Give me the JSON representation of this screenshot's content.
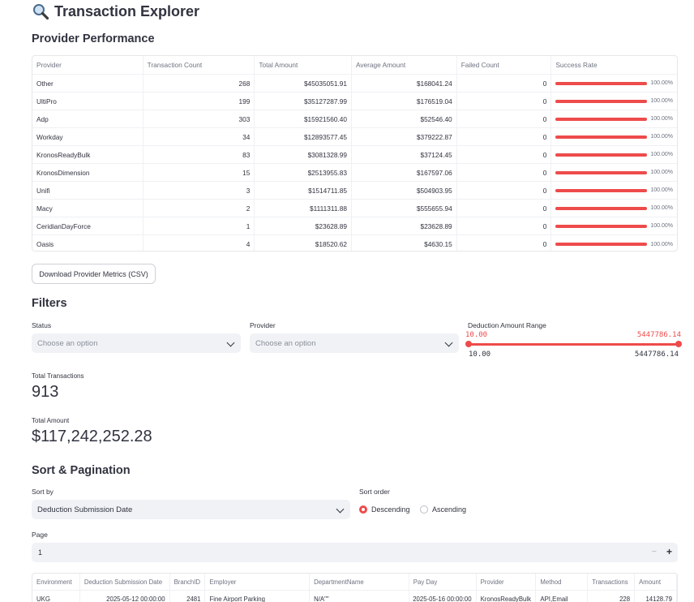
{
  "page": {
    "title": "Transaction Explorer",
    "title_icon": "magnifier-icon"
  },
  "provider_performance": {
    "heading": "Provider Performance",
    "columns": [
      "Provider",
      "Transaction Count",
      "Total Amount",
      "Average Amount",
      "Failed Count",
      "Success Rate"
    ],
    "rows": [
      {
        "provider": "Other",
        "count": "268",
        "total": "$45035051.91",
        "avg": "$168041.24",
        "failed": "0",
        "rate": "100.00%",
        "rate_value": 100
      },
      {
        "provider": "UltiPro",
        "count": "199",
        "total": "$35127287.99",
        "avg": "$176519.04",
        "failed": "0",
        "rate": "100.00%",
        "rate_value": 100
      },
      {
        "provider": "Adp",
        "count": "303",
        "total": "$15921560.40",
        "avg": "$52546.40",
        "failed": "0",
        "rate": "100.00%",
        "rate_value": 100
      },
      {
        "provider": "Workday",
        "count": "34",
        "total": "$12893577.45",
        "avg": "$379222.87",
        "failed": "0",
        "rate": "100.00%",
        "rate_value": 100
      },
      {
        "provider": "KronosReadyBulk",
        "count": "83",
        "total": "$3081328.99",
        "avg": "$37124.45",
        "failed": "0",
        "rate": "100.00%",
        "rate_value": 100
      },
      {
        "provider": "KronosDimension",
        "count": "15",
        "total": "$2513955.83",
        "avg": "$167597.06",
        "failed": "0",
        "rate": "100.00%",
        "rate_value": 100
      },
      {
        "provider": "Unifi",
        "count": "3",
        "total": "$1514711.85",
        "avg": "$504903.95",
        "failed": "0",
        "rate": "100.00%",
        "rate_value": 100
      },
      {
        "provider": "Macy",
        "count": "2",
        "total": "$1111311.88",
        "avg": "$555655.94",
        "failed": "0",
        "rate": "100.00%",
        "rate_value": 100
      },
      {
        "provider": "CeridianDayForce",
        "count": "1",
        "total": "$23628.89",
        "avg": "$23628.89",
        "failed": "0",
        "rate": "100.00%",
        "rate_value": 100
      },
      {
        "provider": "Oasis",
        "count": "4",
        "total": "$18520.62",
        "avg": "$4630.15",
        "failed": "0",
        "rate": "100.00%",
        "rate_value": 100
      }
    ],
    "download_label": "Download Provider Metrics (CSV)"
  },
  "filters": {
    "heading": "Filters",
    "status_label": "Status",
    "status_placeholder": "Choose an option",
    "provider_label": "Provider",
    "provider_placeholder": "Choose an option",
    "range_label": "Deduction Amount Range",
    "range_low": "10.00",
    "range_high": "5447786.14",
    "range_min": "10.00",
    "range_max": "5447786.14"
  },
  "metrics": {
    "total_transactions_label": "Total Transactions",
    "total_transactions_value": "913",
    "total_amount_label": "Total Amount",
    "total_amount_value": "$117,242,252.28"
  },
  "sort": {
    "heading": "Sort & Pagination",
    "sort_by_label": "Sort by",
    "sort_by_value": "Deduction Submission Date",
    "sort_order_label": "Sort order",
    "descending_label": "Descending",
    "ascending_label": "Ascending",
    "selected": "Descending",
    "page_label": "Page",
    "page_value": "1",
    "minus": "−",
    "plus": "+"
  },
  "transactions": {
    "columns": [
      "Environment",
      "Deduction Submission Date",
      "BranchID",
      "Employer",
      "DepartmentName",
      "Pay Day",
      "Provider",
      "Method",
      "Transactions",
      "Amount"
    ],
    "rows": [
      {
        "environment": "UKG",
        "date": "2025-05-12 00:00:00",
        "branch": "2481",
        "employer": "Fine Airport Parking",
        "department": "N/A\"\"",
        "payday": "2025-05-16 00:00:00",
        "provider": "KronosReadyBulk",
        "method": "API,Email",
        "transactions": "228",
        "amount": "14128.79"
      }
    ]
  },
  "colors": {
    "accent": "#ee4b4b",
    "input_bg": "#f0f2f6",
    "text": "#31333f"
  }
}
